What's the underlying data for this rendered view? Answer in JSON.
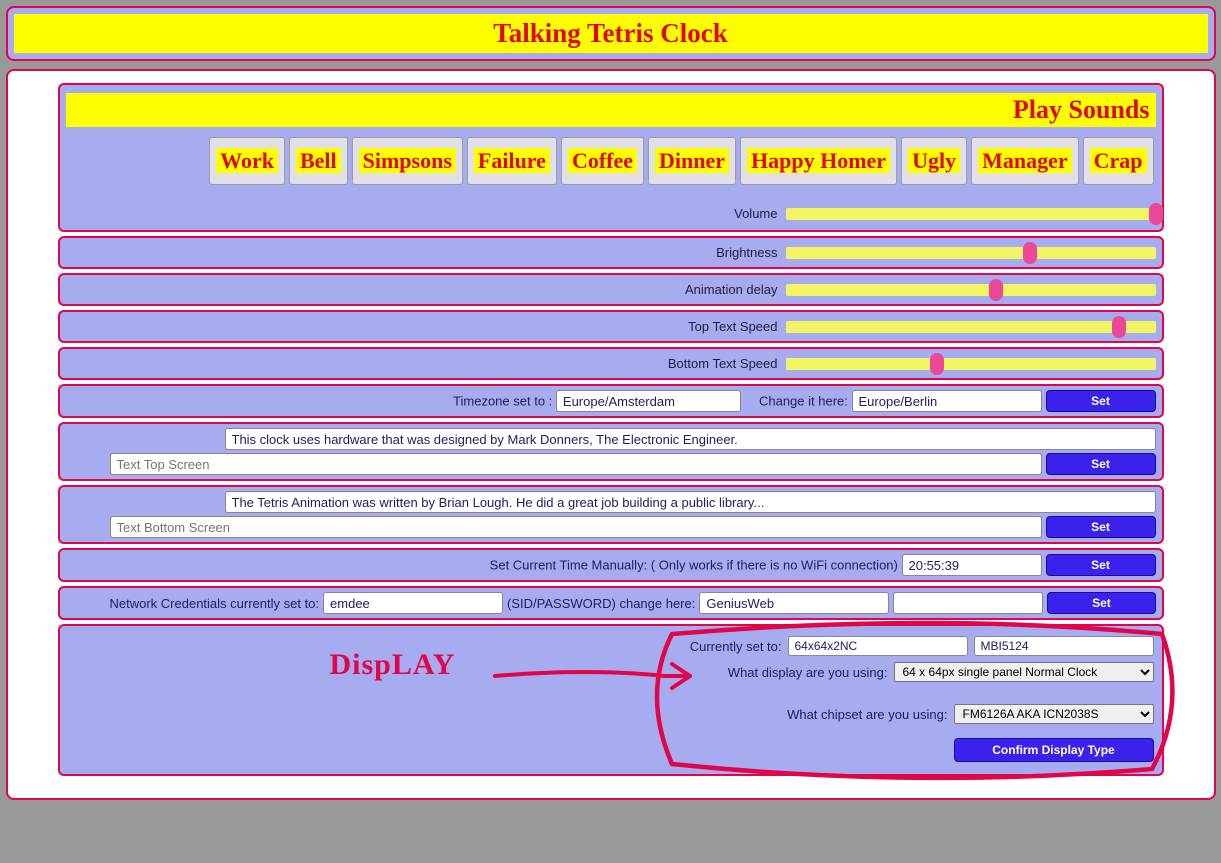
{
  "header": {
    "title": "Talking Tetris Clock"
  },
  "sounds": {
    "heading": "Play Sounds",
    "buttons": [
      "Work",
      "Bell",
      "Simpsons",
      "Failure",
      "Coffee",
      "Dinner",
      "Happy Homer",
      "Ugly",
      "Manager",
      "Crap"
    ],
    "volume_label": "Volume",
    "volume_pct": 100
  },
  "sliders": {
    "brightness": {
      "label": "Brightness",
      "pct": 66
    },
    "anim_delay": {
      "label": "Animation delay",
      "pct": 57
    },
    "top_speed": {
      "label": "Top Text Speed",
      "pct": 90
    },
    "bottom_speed": {
      "label": "Bottom Text Speed",
      "pct": 41
    }
  },
  "timezone": {
    "set_label": "Timezone set to :",
    "current": "Europe/Amsterdam",
    "change_label": "Change it here:",
    "new_val": "Europe/Berlin",
    "set_btn": "Set"
  },
  "top_text": {
    "info": "This clock uses hardware that was designed by Mark Donners, The Electronic Engineer.",
    "placeholder": "Text Top Screen",
    "set_btn": "Set"
  },
  "bottom_text": {
    "info": "The Tetris Animation was written by Brian Lough. He did a great job building a public library...",
    "placeholder": "Text Bottom Screen",
    "set_btn": "Set"
  },
  "time": {
    "label": "Set Current Time Manually: ( Only works if there is no WiFi connection)",
    "value": "20:55:39",
    "set_btn": "Set"
  },
  "network": {
    "label_left": "Network Credentials currently set to:",
    "current": "emdee",
    "label_mid": "(SID/PASSWORD) change here:",
    "ssid": "GeniusWeb",
    "pass": "",
    "set_btn": "Set"
  },
  "display": {
    "current_label": "Currently set to:",
    "current_display": "64x64x2NC",
    "current_chip": "MBI5124",
    "display_q": "What display are you using:",
    "display_sel": "64 x 64px single panel Normal Clock",
    "chip_q": "What chipset are you using:",
    "chip_sel": "FM6126A AKA ICN2038S",
    "confirm_btn": "Confirm Display Type",
    "annotation": "DispLAY"
  }
}
